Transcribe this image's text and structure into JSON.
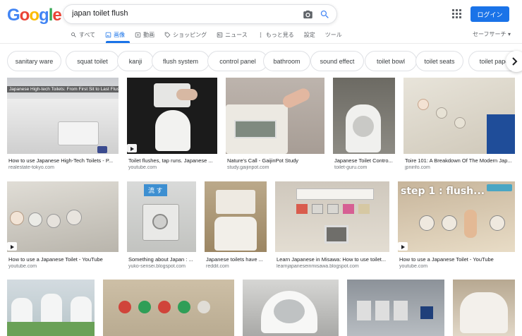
{
  "colors": {
    "google_blue": "#4285F4",
    "google_red": "#EA4335",
    "google_yellow": "#FBBC05",
    "google_green": "#34A853",
    "accent": "#1a73e8"
  },
  "logo": {
    "letters": [
      "G",
      "o",
      "o",
      "g",
      "l",
      "e"
    ]
  },
  "search": {
    "query": "japan toilet flush"
  },
  "header": {
    "login_label": "ログイン"
  },
  "tabs": [
    {
      "label": "すべて",
      "icon": "search-icon"
    },
    {
      "label": "画像",
      "icon": "image-icon",
      "active": true
    },
    {
      "label": "動画",
      "icon": "video-icon"
    },
    {
      "label": "ショッピング",
      "icon": "tag-icon"
    },
    {
      "label": "ニュース",
      "icon": "news-icon"
    },
    {
      "label": "もっと見る",
      "icon": "more-vert-icon"
    },
    {
      "label": "設定"
    },
    {
      "label": "ツール"
    }
  ],
  "safesearch_label": "セーフサーチ ▾",
  "chips": [
    "sanitary ware",
    "squat toilet",
    "kanji",
    "flush system",
    "control panel",
    "bathroom",
    "sound effect",
    "toilet bowl",
    "toilet seats",
    "toilet paper"
  ],
  "results": [
    {
      "caption": "How to use Japanese High-Tech Toilets - P...",
      "source": "realestate-tokyo.com",
      "overlay": "Japanese High-tech Toilets: From First Sit to Last Flush"
    },
    {
      "caption": "Toilet flushes, tap runs. Japanese ...",
      "source": "youtube.com"
    },
    {
      "caption": "Nature's Call - GaijinPot Study",
      "source": "study.gaijinpot.com"
    },
    {
      "caption": "Japanese Toilet Contro...",
      "source": "toilet-guru.com"
    },
    {
      "caption": "Toire 101: A Breakdown Of The Modern Jap...",
      "source": "jpninfo.com"
    },
    {
      "caption": "How to use a Japanese Toilet - YouTube",
      "source": "youtube.com"
    },
    {
      "caption": "Something about Japan : ...",
      "source": "yuko-sensei.blogspot.com",
      "overlay": "流 す"
    },
    {
      "caption": "Japanese toilets have ...",
      "source": "reddit.com"
    },
    {
      "caption": "Learn Japanese in Misawa: How to use toilet...",
      "source": "learnjapaneseinmisawa.blogspot.com"
    },
    {
      "caption": "How to use a Japanese Toilet - YouTube",
      "source": "youtube.com",
      "overlay": "step 1 : flush..."
    },
    {
      "caption": "",
      "source": ""
    },
    {
      "caption": "",
      "source": ""
    },
    {
      "caption": "",
      "source": ""
    },
    {
      "caption": "",
      "source": ""
    },
    {
      "caption": "",
      "source": ""
    }
  ]
}
